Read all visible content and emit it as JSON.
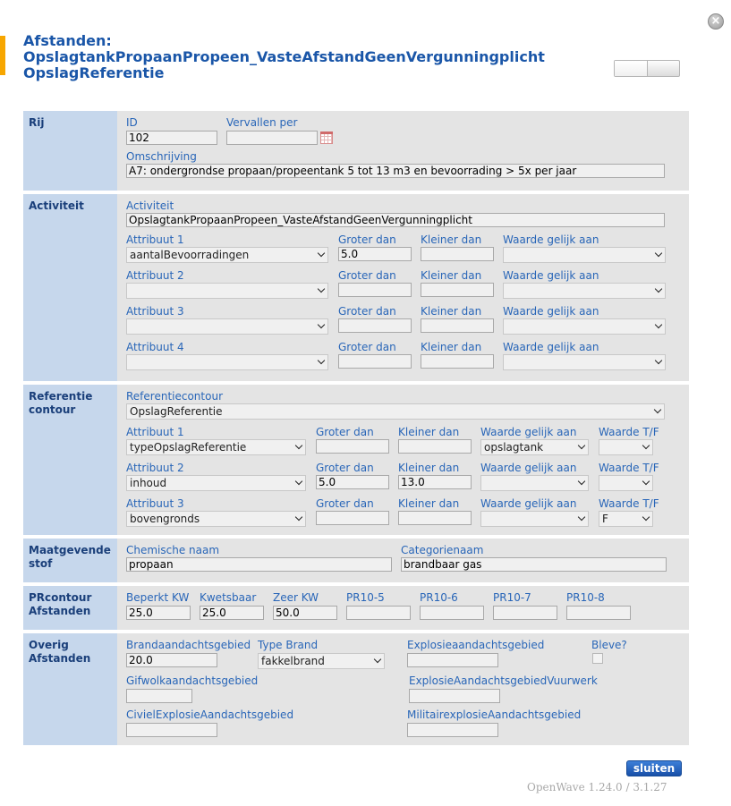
{
  "header": {
    "title_line1": "Afstanden:",
    "title_line2": "OpslagtankPropaanPropeen_VasteAfstandGeenVergunningplicht",
    "title_line3": "OpslagReferentie",
    "close_symbol": "×"
  },
  "rij": {
    "side": "Rij",
    "id_label": "ID",
    "id_value": "102",
    "vervallen_label": "Vervallen per",
    "vervallen_value": "",
    "omschrijving_label": "Omschrijving",
    "omschrijving_value": "A7: ondergrondse propaan/propeentank 5 tot 13 m3 en bevoorrading > 5x per jaar"
  },
  "activiteit": {
    "side": "Activiteit",
    "activiteit_label": "Activiteit",
    "activiteit_value": "OpslagtankPropaanPropeen_VasteAfstandGeenVergunningplicht",
    "groter_label": "Groter dan",
    "kleiner_label": "Kleiner dan",
    "waarde_label": "Waarde gelijk aan",
    "rows": [
      {
        "label": "Attribuut 1",
        "value": "aantalBevoorradingen",
        "groter": "5.0",
        "kleiner": "",
        "waarde": ""
      },
      {
        "label": "Attribuut 2",
        "value": "",
        "groter": "",
        "kleiner": "",
        "waarde": ""
      },
      {
        "label": "Attribuut 3",
        "value": "",
        "groter": "",
        "kleiner": "",
        "waarde": ""
      },
      {
        "label": "Attribuut 4",
        "value": "",
        "groter": "",
        "kleiner": "",
        "waarde": ""
      }
    ]
  },
  "referentie": {
    "side_line1": "Referentie",
    "side_line2": "contour",
    "contour_label": "Referentiecontour",
    "contour_value": "OpslagReferentie",
    "groter_label": "Groter dan",
    "kleiner_label": "Kleiner dan",
    "waarde_label": "Waarde gelijk aan",
    "tf_label": "Waarde T/F",
    "rows": [
      {
        "label": "Attribuut 1",
        "value": "typeOpslagReferentie",
        "groter": "",
        "kleiner": "",
        "waarde": "opslagtank",
        "tf": ""
      },
      {
        "label": "Attribuut 2",
        "value": "inhoud",
        "groter": "5.0",
        "kleiner": "13.0",
        "waarde": "",
        "tf": ""
      },
      {
        "label": "Attribuut 3",
        "value": "bovengronds",
        "groter": "",
        "kleiner": "",
        "waarde": "",
        "tf": "F"
      }
    ]
  },
  "stof": {
    "side_line1": "Maatgevende",
    "side_line2": "stof",
    "chem_label": "Chemische naam",
    "chem_value": "propaan",
    "cat_label": "Categorienaam",
    "cat_value": "brandbaar gas"
  },
  "pr": {
    "side_line1": "PRcontour",
    "side_line2": "Afstanden",
    "fields": [
      {
        "label": "Beperkt KW",
        "value": "25.0"
      },
      {
        "label": "Kwetsbaar",
        "value": "25.0"
      },
      {
        "label": "Zeer KW",
        "value": "50.0"
      },
      {
        "label": "PR10-5",
        "value": ""
      },
      {
        "label": "PR10-6",
        "value": ""
      },
      {
        "label": "PR10-7",
        "value": ""
      },
      {
        "label": "PR10-8",
        "value": ""
      }
    ]
  },
  "overig": {
    "side_line1": "Overig",
    "side_line2": "Afstanden",
    "brand_label": "Brandaandachtsgebied",
    "brand_value": "20.0",
    "type_label": "Type Brand",
    "type_value": "fakkelbrand",
    "explosie_label": "Explosieaandachtsgebied",
    "explosie_value": "",
    "bleve_label": "Bleve?",
    "gifwolk_label": "Gifwolkaandachtsgebied",
    "gifwolk_value": "",
    "vuurwerk_label": "ExplosieAandachtsgebiedVuurwerk",
    "vuurwerk_value": "",
    "civiel_label": "CivielExplosieAandachtsgebied",
    "civiel_value": "",
    "militair_label": "MilitairexplosieAandachtsgebied",
    "militair_value": ""
  },
  "footer": {
    "close_button": "sluiten",
    "version": "OpenWave 1.24.0 / 3.1.27"
  }
}
